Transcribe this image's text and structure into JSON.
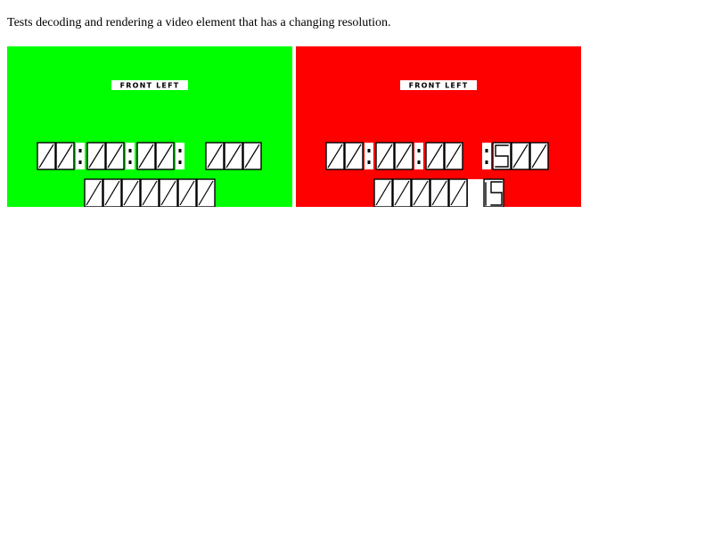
{
  "description": "Tests decoding and rendering a video element that has a changing resolution.",
  "colors": {
    "left_frame_background": "#00ff00",
    "right_frame_background": "#ff0000"
  },
  "videos": [
    {
      "label": "FRONT LEFT",
      "timecode": "00:00:00:000",
      "frame_counter": "0000000",
      "background": "#00ff00"
    },
    {
      "label": "FRONT LEFT",
      "timecode": "00:00:00:500",
      "frame_counter": "00000 15",
      "background": "#ff0000"
    }
  ]
}
